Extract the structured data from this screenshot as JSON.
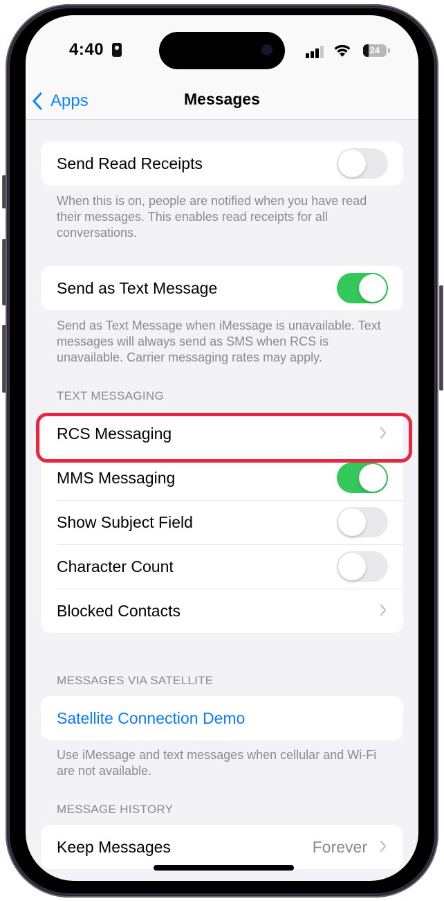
{
  "status_bar": {
    "time": "4:40",
    "battery_percent": "24",
    "battery_level": 0.24,
    "signal_bars_active": 3,
    "signal_bars_total": 4,
    "icons": [
      "contact-card-icon",
      "cellular-signal-icon",
      "wifi-icon",
      "battery-icon"
    ]
  },
  "nav": {
    "back_label": "Apps",
    "title": "Messages"
  },
  "sections": {
    "read_receipts": {
      "label": "Send Read Receipts",
      "enabled": false,
      "footer": "When this is on, people are notified when you have read their messages. This enables read receipts for all conversations."
    },
    "send_as_text": {
      "label": "Send as Text Message",
      "enabled": true,
      "footer": "Send as Text Message when iMessage is unavailable. Text messages will always send as SMS when RCS is unavailable. Carrier messaging rates may apply."
    },
    "text_messaging": {
      "header": "TEXT MESSAGING",
      "rows": [
        {
          "label": "RCS Messaging",
          "type": "disclosure",
          "highlighted": true
        },
        {
          "label": "MMS Messaging",
          "type": "toggle",
          "enabled": true
        },
        {
          "label": "Show Subject Field",
          "type": "toggle",
          "enabled": false
        },
        {
          "label": "Character Count",
          "type": "toggle",
          "enabled": false
        },
        {
          "label": "Blocked Contacts",
          "type": "disclosure"
        }
      ]
    },
    "satellite": {
      "header": "MESSAGES VIA SATELLITE",
      "link_label": "Satellite Connection Demo",
      "footer": "Use iMessage and text messages when cellular and Wi-Fi are not available."
    },
    "history": {
      "header": "MESSAGE HISTORY",
      "row_label": "Keep Messages",
      "row_value": "Forever"
    }
  },
  "colors": {
    "accent_blue": "#0a84ff",
    "toggle_on": "#34c759",
    "toggle_off": "#e9e9eb",
    "highlight_red": "#e8273f",
    "background": "#f2f2f7"
  }
}
